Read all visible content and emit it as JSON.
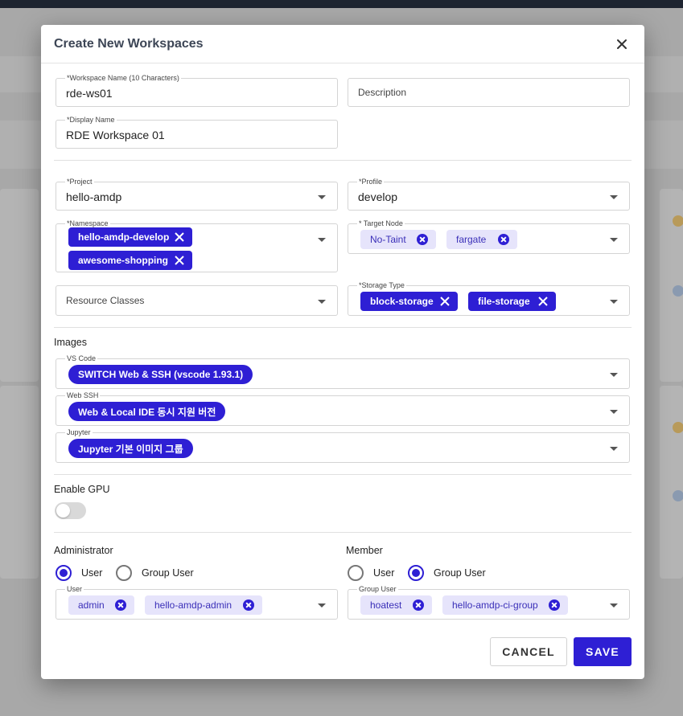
{
  "modal": {
    "title": "Create New Workspaces"
  },
  "fields": {
    "workspace_name": {
      "label": "*Workspace Name (10 Characters)",
      "value": "rde-ws01"
    },
    "description": {
      "placeholder": "Description"
    },
    "display_name": {
      "label": "*Display Name",
      "value": "RDE Workspace 01"
    },
    "project": {
      "label": "*Project",
      "value": "hello-amdp"
    },
    "profile": {
      "label": "*Profile",
      "value": "develop"
    },
    "namespace": {
      "label": "*Namespace",
      "chips": [
        "hello-amdp-develop",
        "awesome-shopping"
      ]
    },
    "target_node": {
      "label": "* Target Node",
      "chips": [
        "No-Taint",
        "fargate"
      ]
    },
    "resource_classes": {
      "placeholder": "Resource Classes"
    },
    "storage_type": {
      "label": "*Storage Type",
      "chips": [
        "block-storage",
        "file-storage"
      ]
    }
  },
  "images": {
    "section_label": "Images",
    "vscode": {
      "label": "VS Code",
      "chip": "SWITCH Web & SSH (vscode 1.93.1)"
    },
    "webssh": {
      "label": "Web SSH",
      "chip": "Web & Local IDE 동시 지원 버전"
    },
    "jupyter": {
      "label": "Jupyter",
      "chip": "Jupyter 기본 이미지 그룹"
    }
  },
  "gpu": {
    "label": "Enable GPU",
    "enabled": false
  },
  "administrator": {
    "label": "Administrator",
    "options": [
      "User",
      "Group User"
    ],
    "selected": "User",
    "field_label": "User",
    "chips": [
      "admin",
      "hello-amdp-admin"
    ]
  },
  "member": {
    "label": "Member",
    "options": [
      "User",
      "Group User"
    ],
    "selected": "Group User",
    "field_label": "Group User",
    "chips": [
      "hoatest",
      "hello-amdp-ci-group"
    ]
  },
  "footer": {
    "cancel_label": "CANCEL",
    "save_label": "SAVE"
  },
  "colors": {
    "accent": "#2e1fd4",
    "chip_light": "#e6e4fb",
    "title": "#3d4656"
  }
}
